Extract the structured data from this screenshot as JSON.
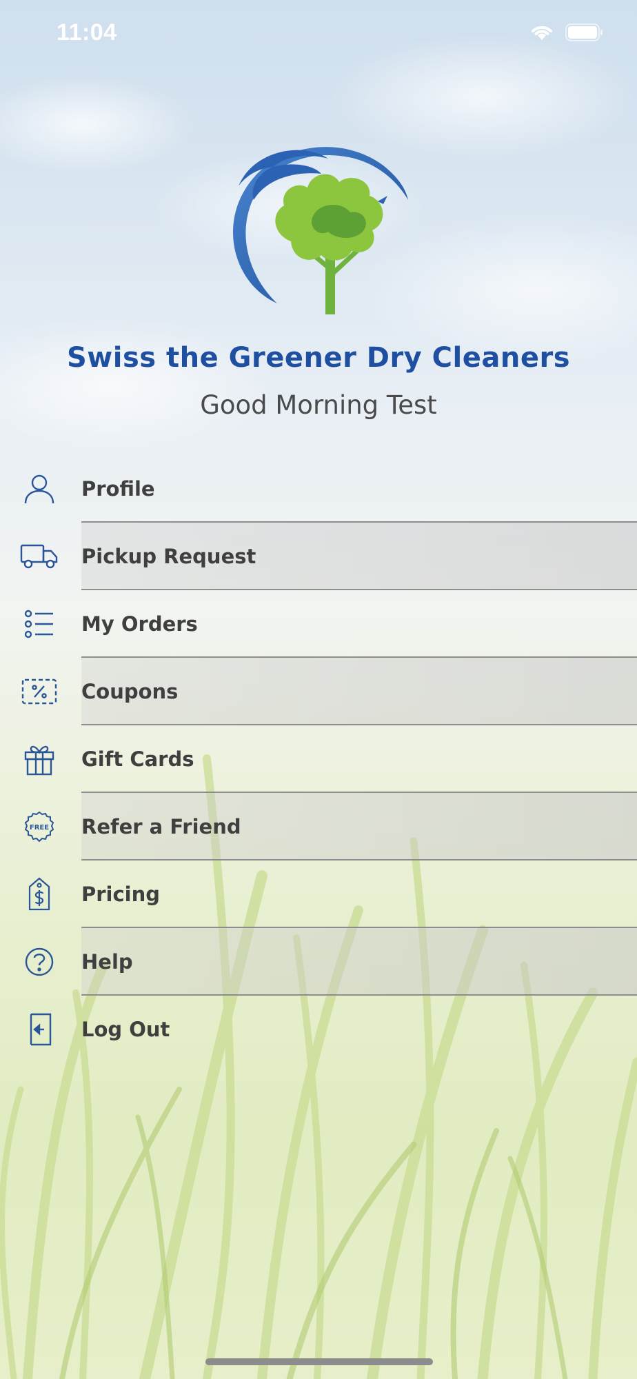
{
  "status_bar": {
    "time": "11:04"
  },
  "brand": {
    "name": "Swiss the Greener Dry Cleaners",
    "greeting": "Good Morning Test"
  },
  "menu": {
    "items": [
      {
        "label": "Profile",
        "icon": "person-icon"
      },
      {
        "label": "Pickup Request",
        "icon": "truck-icon"
      },
      {
        "label": "My Orders",
        "icon": "list-icon"
      },
      {
        "label": "Coupons",
        "icon": "percent-coupon-icon"
      },
      {
        "label": "Gift Cards",
        "icon": "gift-icon"
      },
      {
        "label": "Refer a Friend",
        "icon": "free-badge-icon",
        "icon_text": "FREE"
      },
      {
        "label": "Pricing",
        "icon": "price-tag-icon"
      },
      {
        "label": "Help",
        "icon": "question-icon"
      },
      {
        "label": "Log Out",
        "icon": "logout-icon"
      }
    ]
  },
  "colors": {
    "brand_blue": "#1f4fa0",
    "icon_blue": "#2a5598",
    "label_gray": "#3f3f3f",
    "tree_green": "#6fb33e"
  }
}
